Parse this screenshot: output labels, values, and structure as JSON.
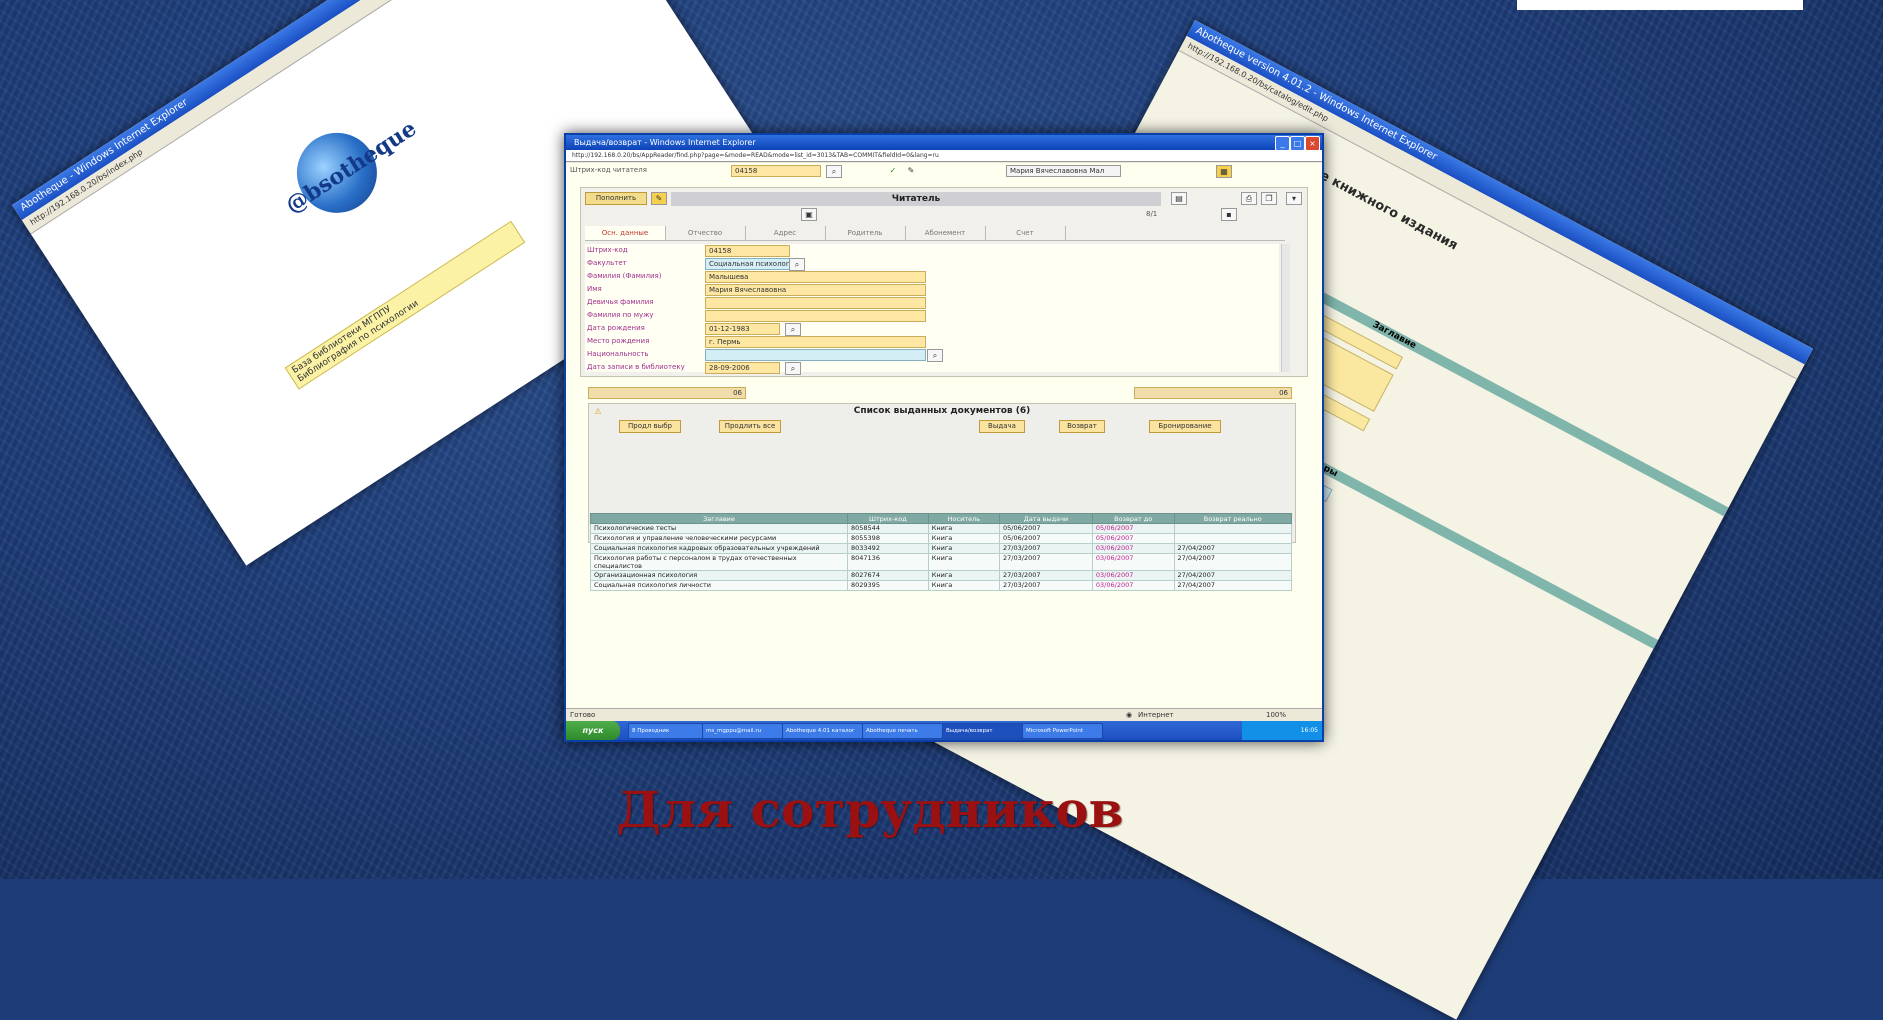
{
  "caption": "Для сотрудников",
  "left_window": {
    "title": "Abotheque - Windows Internet Explorer",
    "logo_text": "@bsotheque",
    "menu_items": [
      "База библиотеки МГППУ",
      "Библиография по психологии"
    ]
  },
  "right_window": {
    "title": "Abotheque version 4.01.2 - Windows Internet Explorer",
    "header": "Описание книжного издания",
    "sections": [
      "Заглавие",
      "Авторы"
    ]
  },
  "main_window": {
    "title": "Выдача/возврат - Windows Internet Explorer",
    "address": "http://192.168.0.20/bs/AppReader/find.php?page=&mode=READ&mode=list_id=3013&TAB=COMMIT&fieldId=0&lang=ru",
    "barcode_label": "Штрих-код читателя",
    "barcode_value": "04158",
    "user_select": "Мария Вячеславовна Мал",
    "reader_panel": {
      "button_label": "Пополнить",
      "title": "Читатель",
      "page_value": "8/1",
      "tabs": [
        "Осн. данные",
        "Отчество",
        "Адрес",
        "Родитель",
        "Абонемент",
        "Счет"
      ],
      "fields": [
        {
          "label": "Штрих-код",
          "value": "04158"
        },
        {
          "label": "Факультет",
          "value": "Социальная психология"
        },
        {
          "label": "Фамилия (Фамилия)",
          "value": "Малышева"
        },
        {
          "label": "Имя",
          "value": "Мария Вячеславовна"
        },
        {
          "label": "Девичья фамилия",
          "value": ""
        },
        {
          "label": "Фамилия по мужу",
          "value": ""
        },
        {
          "label": "Дата рождения",
          "value": "01-12-1983"
        },
        {
          "label": "Место рождения",
          "value": "г. Пермь"
        },
        {
          "label": "Национальность",
          "value": ""
        },
        {
          "label": "Дата записи в библиотеку",
          "value": "28-09-2006"
        }
      ]
    },
    "counter_left": "06",
    "counter_right": "06",
    "docs": {
      "title": "Список выданных документов (6)",
      "buttons": [
        "Продл выбр",
        "Продлить все",
        "Выдача",
        "Возврат",
        "Бронирование"
      ],
      "columns": [
        "Заглавие",
        "Штрих-код",
        "Носитель",
        "Дата выдачи",
        "Возврат до",
        "Возврат реально"
      ],
      "rows": [
        [
          "Психологические тесты",
          "8058544",
          "Книга",
          "05/06/2007",
          "05/06/2007",
          ""
        ],
        [
          "Психология и управление человеческими ресурсами",
          "8055398",
          "Книга",
          "05/06/2007",
          "05/06/2007",
          ""
        ],
        [
          "Социальная психология кадровых образовательных учреждений",
          "8033492",
          "Книга",
          "27/03/2007",
          "03/06/2007",
          "27/04/2007"
        ],
        [
          "Психология работы с персоналом в трудах отечественных специалистов",
          "8047136",
          "Книга",
          "27/03/2007",
          "03/06/2007",
          "27/04/2007"
        ],
        [
          "Организационная психология",
          "8027674",
          "Книга",
          "27/03/2007",
          "03/06/2007",
          "27/04/2007"
        ],
        [
          "Социальная психология личности",
          "8029395",
          "Книга",
          "27/03/2007",
          "03/06/2007",
          "27/04/2007"
        ]
      ]
    },
    "status_left": "Готово",
    "status_zone": "Интернет",
    "status_zoom": "100%",
    "taskbar": {
      "start": "пуск",
      "tasks": [
        "8 Проводник",
        "ms_mgppu@mail.ru",
        "Abotheque 4.01 каталог",
        "Abotheque печать",
        "Выдача/возврат",
        "Microsoft PowerPoint"
      ],
      "clock": "16:05"
    }
  }
}
